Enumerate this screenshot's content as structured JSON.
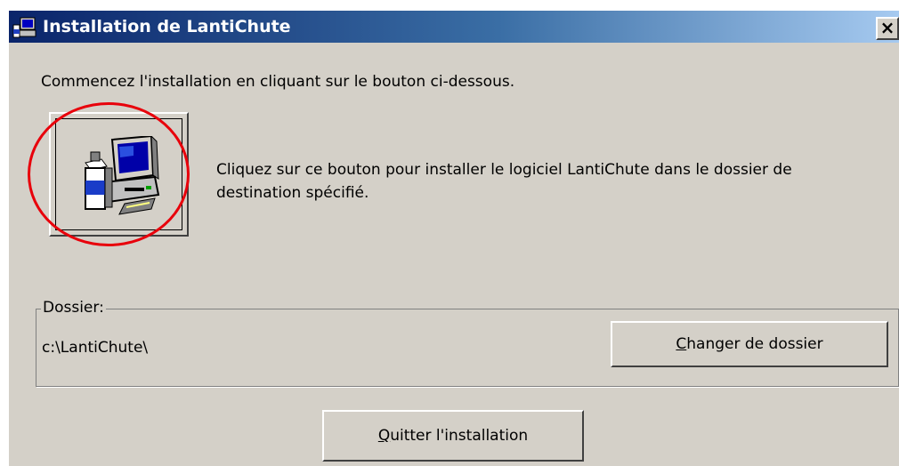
{
  "window": {
    "title": "Installation de LantiChute",
    "close_label": "×"
  },
  "instructions": "Commencez l'installation en cliquant sur le bouton ci-dessous.",
  "install": {
    "icon": "setup-computer-icon",
    "description_line1": "Cliquez sur ce bouton pour installer le logiciel LantiChute dans le dossier de",
    "description_line2": "destination spécifié."
  },
  "folder": {
    "legend": "Dossier:",
    "path": "c:\\LantiChute\\",
    "change_button_mnemonic": "C",
    "change_button_rest": "hanger de dossier"
  },
  "quit_button": {
    "mnemonic": "Q",
    "rest": "uitter l'installation"
  },
  "annotation": {
    "highlight_color": "#e8000b"
  },
  "colors": {
    "window_bg": "#d4d0c8",
    "titlebar_start": "#0a246a",
    "titlebar_end": "#a6caf0"
  }
}
